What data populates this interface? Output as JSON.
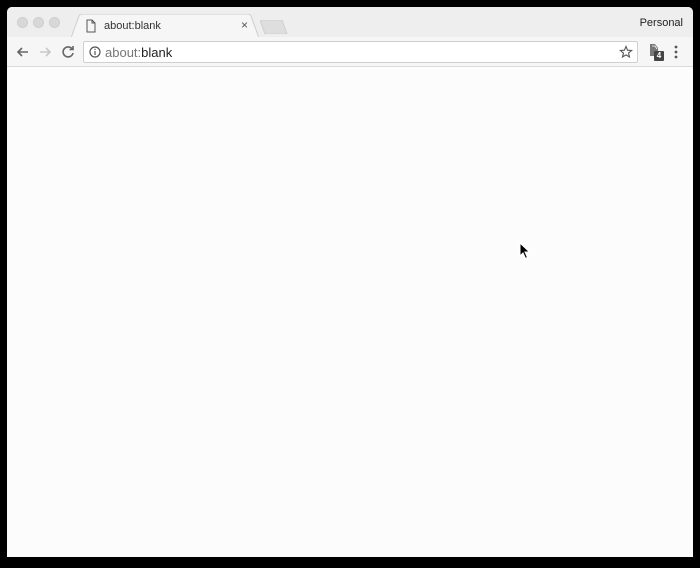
{
  "window": {
    "tab": {
      "title": "about:blank",
      "close_glyph": "×",
      "icon": "document-icon"
    },
    "profile_label": "Personal"
  },
  "toolbar": {
    "url_scheme": "about:",
    "url_rest": "blank",
    "extension_badge": "4"
  },
  "colors": {
    "chrome_bg": "#eeeeee",
    "toolbar_bg": "#f6f6f6",
    "page_bg": "#fdfcfd"
  }
}
